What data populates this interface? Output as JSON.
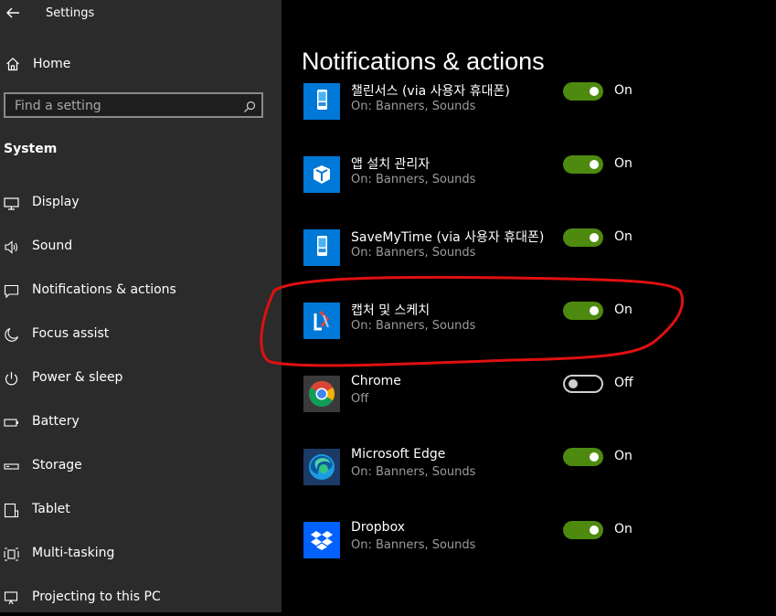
{
  "window": {
    "title": "Settings"
  },
  "sidebar": {
    "home_label": "Home",
    "search_placeholder": "Find a setting",
    "section_title": "System",
    "items": [
      {
        "label": "Display",
        "icon": "display-icon"
      },
      {
        "label": "Sound",
        "icon": "sound-icon"
      },
      {
        "label": "Notifications & actions",
        "icon": "notification-icon"
      },
      {
        "label": "Focus assist",
        "icon": "moon-icon"
      },
      {
        "label": "Power & sleep",
        "icon": "power-icon"
      },
      {
        "label": "Battery",
        "icon": "battery-icon"
      },
      {
        "label": "Storage",
        "icon": "storage-icon"
      },
      {
        "label": "Tablet",
        "icon": "tablet-icon"
      },
      {
        "label": "Multi-tasking",
        "icon": "multitasking-icon"
      },
      {
        "label": "Projecting to this PC",
        "icon": "projecting-icon"
      }
    ]
  },
  "main": {
    "title": "Notifications & actions",
    "apps": [
      {
        "name": "챌린서스 (via 사용자 휴대폰)",
        "sub": "On: Banners, Sounds",
        "state": "On",
        "on": true,
        "icon": "phone-app-icon",
        "icon_bg": "#0078d7"
      },
      {
        "name": "앱 설치 관리자",
        "sub": "On: Banners, Sounds",
        "state": "On",
        "on": true,
        "icon": "app-installer-icon",
        "icon_bg": "#0078d7"
      },
      {
        "name": "SaveMyTime (via 사용자 휴대폰)",
        "sub": "On: Banners, Sounds",
        "state": "On",
        "on": true,
        "icon": "phone-app-icon",
        "icon_bg": "#0078d7"
      },
      {
        "name": "캡처 및 스케치",
        "sub": "On: Banners, Sounds",
        "state": "On",
        "on": true,
        "icon": "snip-sketch-icon",
        "icon_bg": "#0078d7"
      },
      {
        "name": "Chrome",
        "sub": "Off",
        "state": "Off",
        "on": false,
        "icon": "chrome-icon",
        "icon_bg": "#3a3a3a"
      },
      {
        "name": "Microsoft Edge",
        "sub": "On: Banners, Sounds",
        "state": "On",
        "on": true,
        "icon": "edge-icon",
        "icon_bg": "#1c3a66"
      },
      {
        "name": "Dropbox",
        "sub": "On: Banners, Sounds",
        "state": "On",
        "on": true,
        "icon": "dropbox-icon",
        "icon_bg": "#0061fe"
      }
    ]
  },
  "colors": {
    "toggle_on": "#4f8a10",
    "sidebar_bg": "#2b2b2b",
    "annotation": "#e01010"
  }
}
